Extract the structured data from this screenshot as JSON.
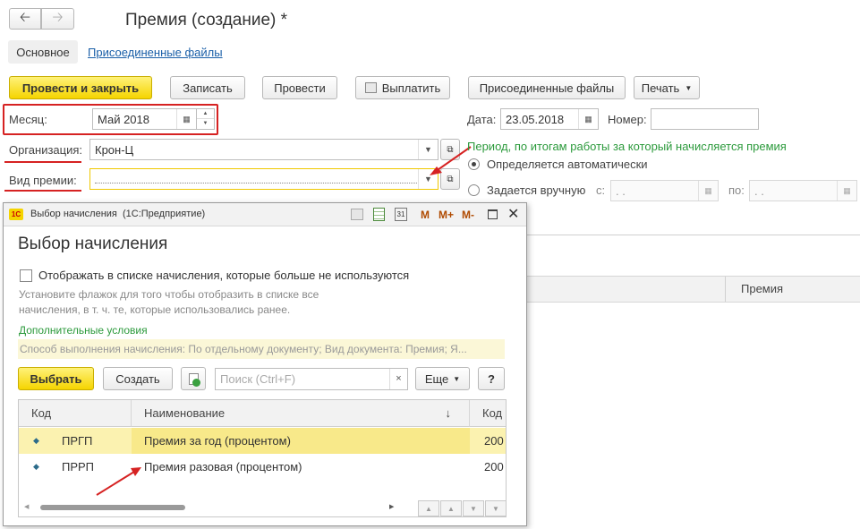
{
  "header": {
    "back_icon": "arrow-left-icon",
    "forward_icon": "arrow-right-icon",
    "title": "Премия (создание) *"
  },
  "tabs": {
    "main": "Основное",
    "attached": "Присоединенные файлы"
  },
  "toolbar": {
    "post_close": "Провести и закрыть",
    "save": "Записать",
    "post": "Провести",
    "pay": "Выплатить",
    "attached_files": "Присоединенные файлы",
    "print": "Печать"
  },
  "form": {
    "month_label": "Месяц:",
    "month_value": "Май 2018",
    "date_label": "Дата:",
    "date_value": "23.05.2018",
    "number_label": "Номер:",
    "number_value": "",
    "org_label": "Организация:",
    "org_value": "Крон-Ц",
    "bonus_type_label": "Вид премии:",
    "bonus_type_value": "",
    "period_title": "Период, по итогам работы за который начисляется премия",
    "radio_auto": "Определяется автоматически",
    "radio_manual": "Задается вручную",
    "from_label": "с:",
    "from_value": " .  .",
    "to_label": "по:",
    "to_value": " .  .",
    "right_col_header": "Премия"
  },
  "dialog": {
    "window_title": "Выбор начисления  (1С:Предприятие)",
    "title_buttons": [
      "M",
      "M+",
      "M-"
    ],
    "heading": "Выбор начисления",
    "checkbox_label": "Отображать в списке начисления, которые больше не используются",
    "hint_line1": "Установите флажок для того чтобы отобразить в списке все",
    "hint_line2": "начисления, в т. ч. те, которые использовались ранее.",
    "extra_conditions": "Дополнительные условия",
    "conditions_text": "Способ выполнения начисления: По отдельному документу; Вид документа: Премия; Я...",
    "select_btn": "Выбрать",
    "create_btn": "Создать",
    "search_placeholder": "Поиск (Ctrl+F)",
    "more_btn": "Еще",
    "help_btn": "?",
    "columns": [
      "Код",
      "Наименование",
      "Код"
    ],
    "rows": [
      {
        "code": "ПРГП",
        "name": "Премия за год (процентом)",
        "code2": "200"
      },
      {
        "code": "ПРРП",
        "name": "Премия разовая (процентом)",
        "code2": "200"
      }
    ]
  },
  "colors": {
    "accent_yellow": "#f5d400",
    "annotation_red": "#d62222",
    "period_green": "#2c9a3c",
    "selected_row": "#fbf2b0"
  }
}
